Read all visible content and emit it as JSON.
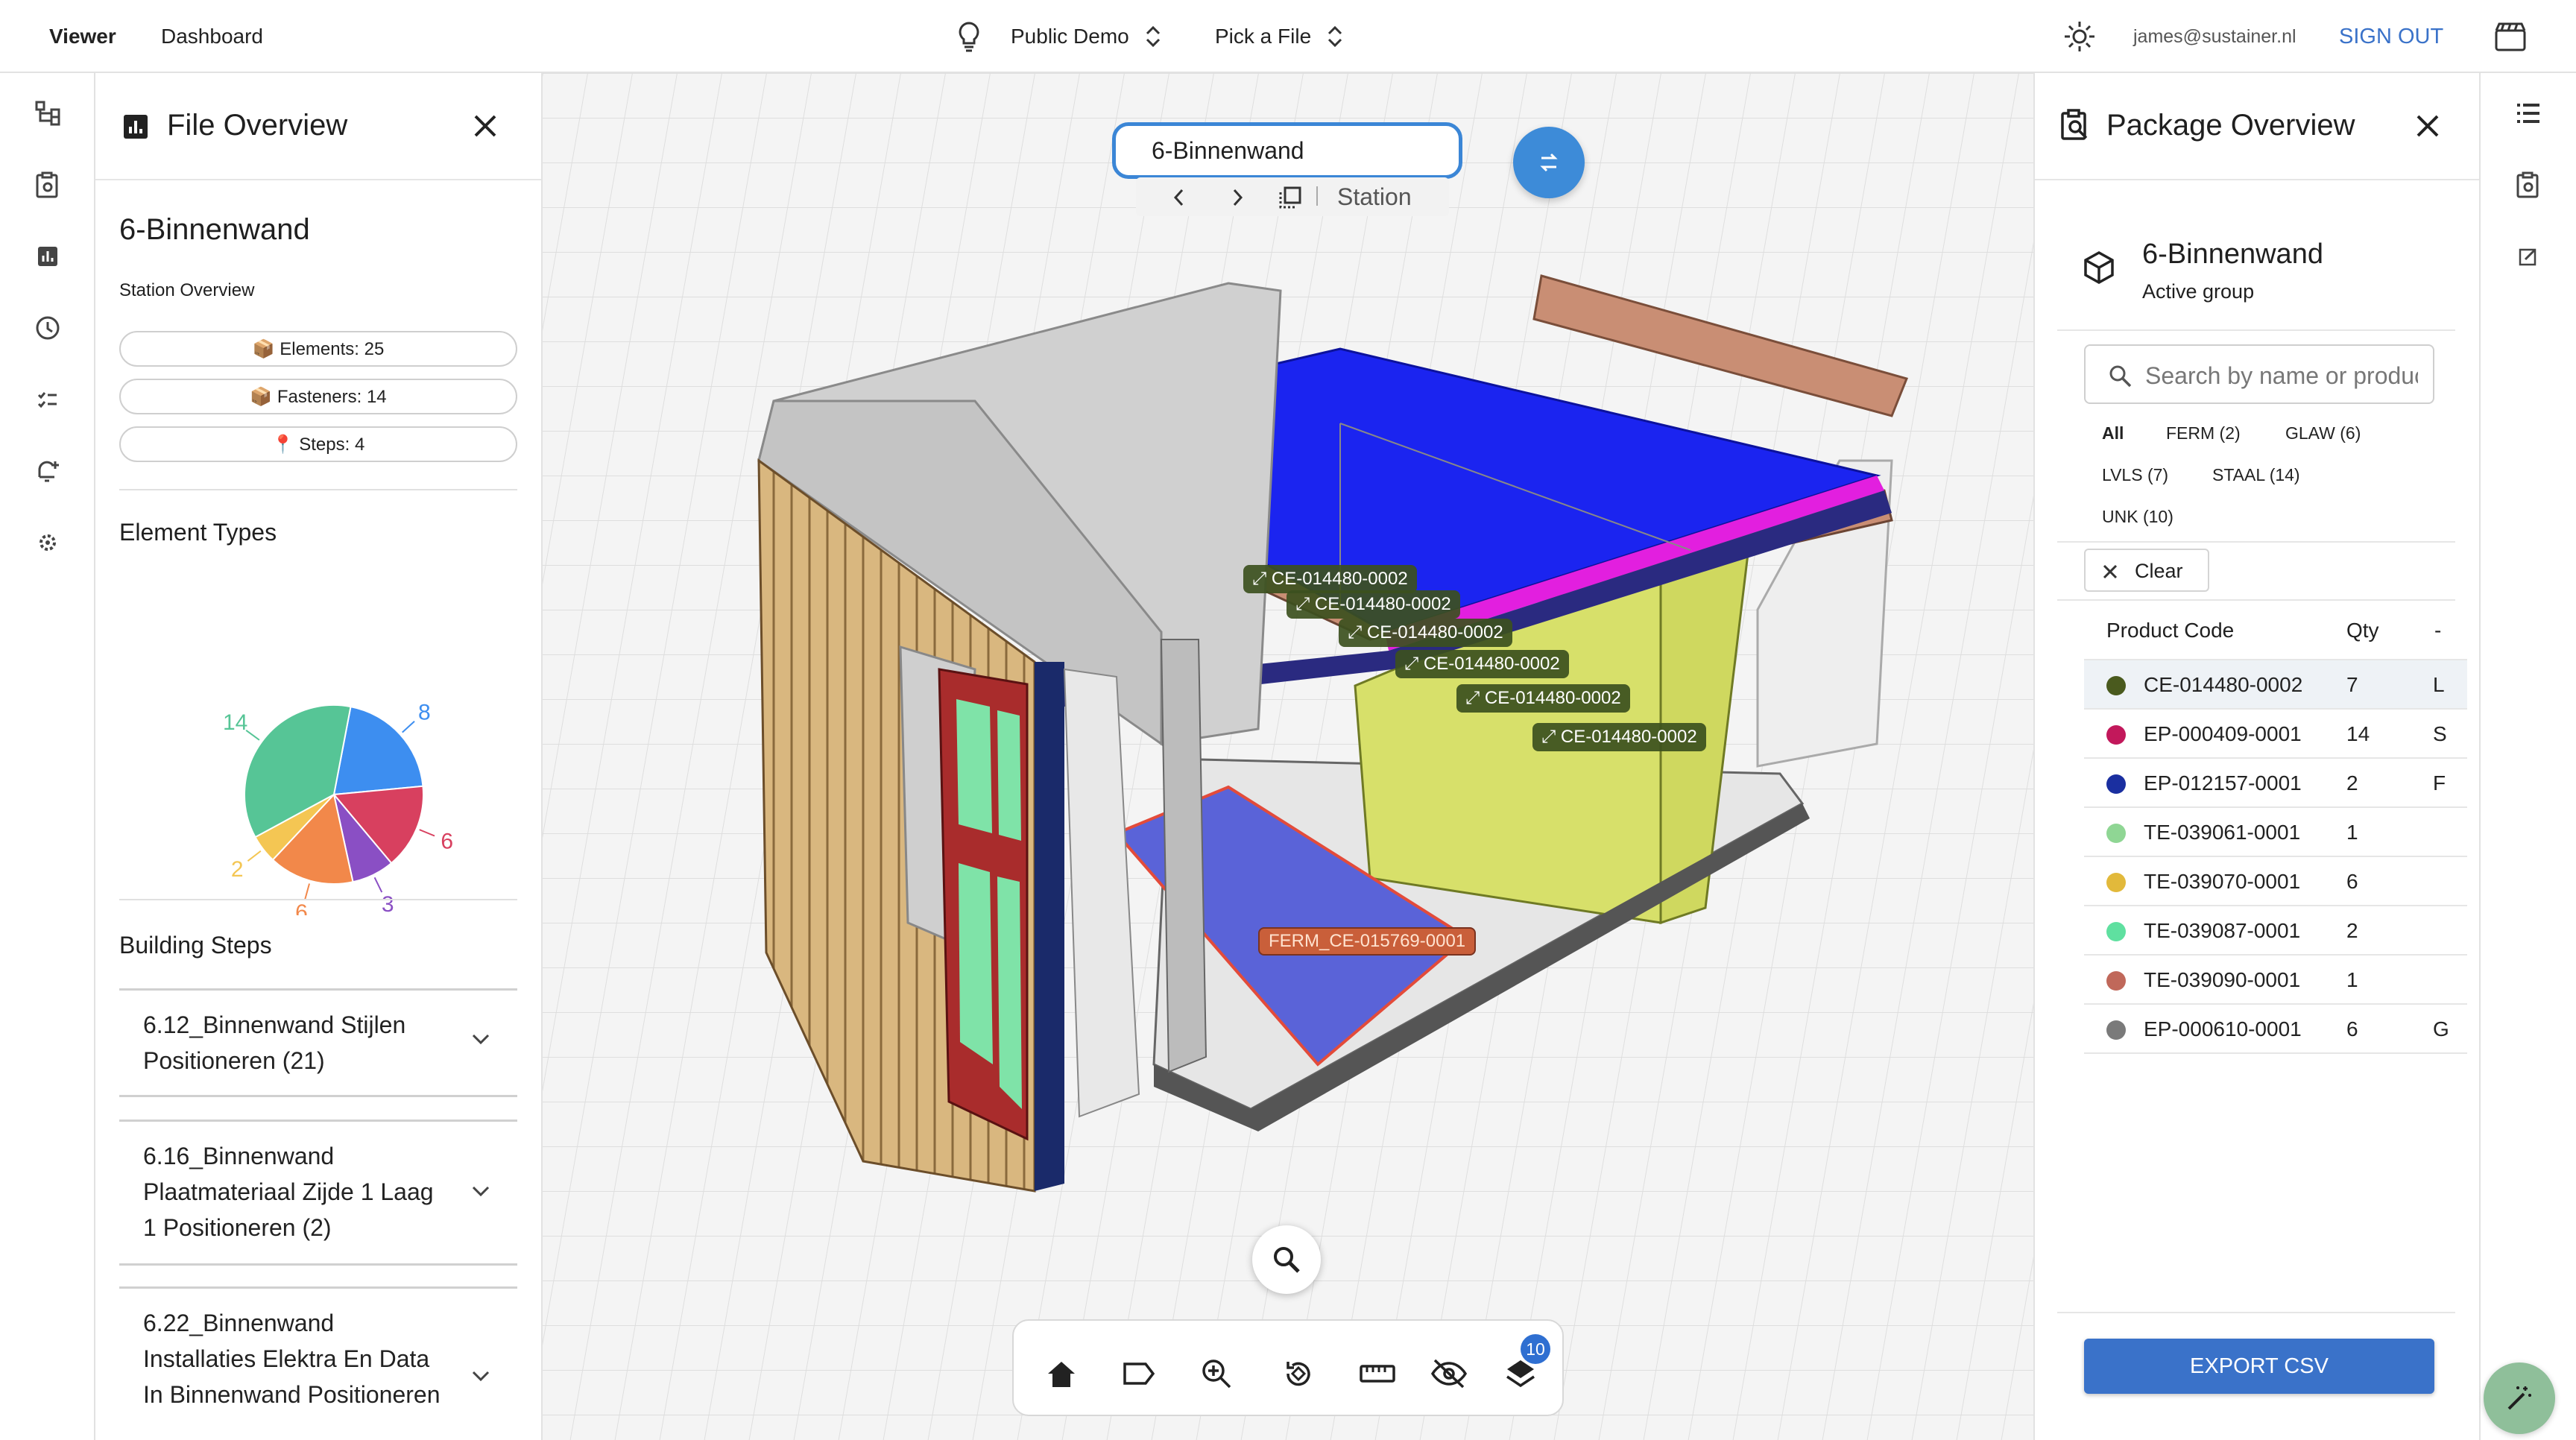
{
  "nav": {
    "viewer": "Viewer",
    "dashboard": "Dashboard",
    "project": "Public Demo",
    "file": "Pick a File",
    "email": "james@sustainer.nl",
    "sign_out": "SIGN OUT"
  },
  "file_overview": {
    "title": "File Overview",
    "name": "6-Binnenwand",
    "station_overview": "Station Overview",
    "pills": {
      "elements": "📦 Elements: 25",
      "fasteners": "📦 Fasteners: 14",
      "steps": "📍 Steps: 4"
    },
    "element_types_title": "Element Types",
    "pie": [
      {
        "label": "14",
        "value": 14,
        "color": "#56c596"
      },
      {
        "label": "8",
        "value": 8,
        "color": "#3d8ef0"
      },
      {
        "label": "6",
        "value": 6,
        "color": "#d8405f"
      },
      {
        "label": "3",
        "value": 3,
        "color": "#8a4fc4"
      },
      {
        "label": "6",
        "value": 6,
        "color": "#f2884a"
      },
      {
        "label": "2",
        "value": 2,
        "color": "#f4c653"
      }
    ],
    "building_steps_title": "Building Steps",
    "steps": [
      {
        "line1": "6.12_Binnenwand Stijlen",
        "line2": "Positioneren (21)",
        "line3": ""
      },
      {
        "line1": "6.16_Binnenwand",
        "line2": "Plaatmateriaal Zijde 1 Laag",
        "line3": "1 Positioneren (2)"
      },
      {
        "line1": "6.22_Binnenwand",
        "line2": "Installaties Elektra En Data",
        "line3": "In Binnenwand Positioneren"
      }
    ]
  },
  "viewer": {
    "search_value": "6-Binnenwand",
    "station_label": "Station",
    "tags": [
      "CE-014480-0002",
      "CE-014480-0002",
      "CE-014480-0002",
      "CE-014480-0002",
      "CE-014480-0002",
      "CE-014480-0002"
    ],
    "highlight_tag": "FERM_CE-015769-0001",
    "layers_badge": "10"
  },
  "package_overview": {
    "title": "Package Overview",
    "group_name": "6-Binnenwand",
    "group_sub": "Active group",
    "search_placeholder": "Search by name or product",
    "filters": [
      "All",
      "FERM (2)",
      "GLAW (6)",
      "LVLS (7)",
      "STAAL (14)",
      "UNK (10)"
    ],
    "clear": "Clear",
    "col_code": "Product Code",
    "col_qty": "Qty",
    "col_extra": "-",
    "rows": [
      {
        "code": "CE-014480-0002",
        "qty": "7",
        "x": "L",
        "color": "#4a5a1e"
      },
      {
        "code": "EP-000409-0001",
        "qty": "14",
        "x": "S",
        "color": "#c2185b"
      },
      {
        "code": "EP-012157-0001",
        "qty": "2",
        "x": "F",
        "color": "#1a2fa0"
      },
      {
        "code": "TE-039061-0001",
        "qty": "1",
        "x": "",
        "color": "#8fd694"
      },
      {
        "code": "TE-039070-0001",
        "qty": "6",
        "x": "",
        "color": "#e2b93b"
      },
      {
        "code": "TE-039087-0001",
        "qty": "2",
        "x": "",
        "color": "#5fe0a0"
      },
      {
        "code": "TE-039090-0001",
        "qty": "1",
        "x": "",
        "color": "#c0685a"
      },
      {
        "code": "EP-000610-0001",
        "qty": "6",
        "x": "G",
        "color": "#7a7a7a"
      }
    ],
    "export": "EXPORT CSV"
  },
  "colors": {
    "accent": "#3a72c9",
    "fab": "#3d8bd8"
  }
}
